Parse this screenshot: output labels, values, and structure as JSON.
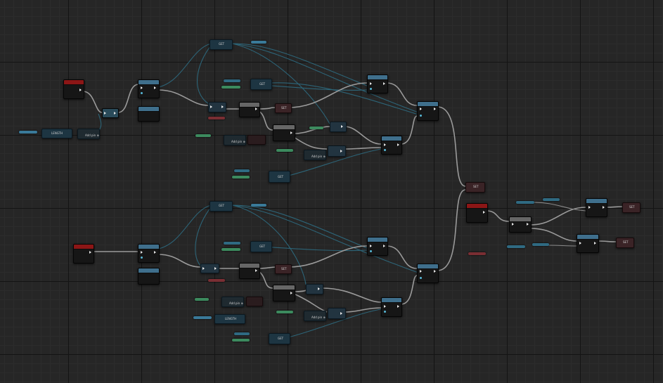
{
  "graph": {
    "nodes": {
      "length_upper": "LENGTH",
      "length_lower": "LENGTH",
      "get_1": "GET",
      "get_2": "GET",
      "get_3": "GET",
      "get_4": "GET",
      "get_5": "GET",
      "get_6": "GET",
      "set_1": "SET",
      "set_2": "SET",
      "set_3": "SET",
      "set_4": "SET",
      "set_5": "SET",
      "add_pin_1": "Add pin ⊕",
      "add_pin_2": "Add pin ⊕",
      "add_pin_3": "Add pin ⊕",
      "add_pin_4": "Add pin ⊕",
      "add_pin_5": "Add pin ⊕"
    }
  },
  "colors": {
    "background": "#262626",
    "event_header": "#8c1616",
    "function_header": "#3f6f8c",
    "exec_wire": "#9a9a9a",
    "data_wire": "#2e6f86",
    "struct_pill": "#2f6a82",
    "bool_pill": "#3c8a5e",
    "var_pill_red": "#7a2e33"
  },
  "icons": [
    "exec-pin-icon",
    "data-pin-icon"
  ]
}
